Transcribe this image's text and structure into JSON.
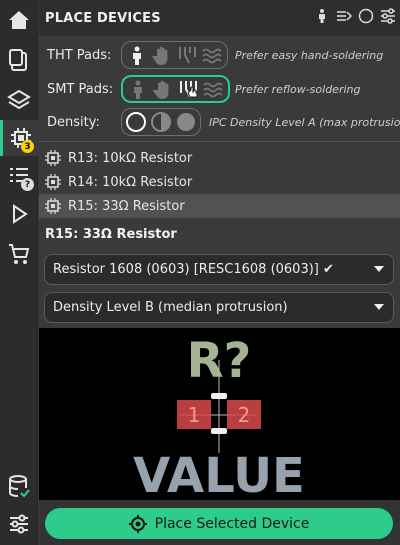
{
  "sidebar": {
    "items": [
      {
        "icon": "home-icon"
      },
      {
        "icon": "clipboard-icon"
      },
      {
        "icon": "layers-icon"
      },
      {
        "icon": "chip-icon",
        "badge": "3"
      },
      {
        "icon": "list-icon",
        "badge": "?"
      },
      {
        "icon": "play-icon"
      },
      {
        "icon": "cart-icon"
      },
      {
        "icon": "database-icon"
      },
      {
        "icon": "settings-sliders-icon"
      }
    ]
  },
  "header": {
    "title": "PLACE DEVICES"
  },
  "options": {
    "tht_label": "THT Pads:",
    "tht_hint": "Prefer easy hand-soldering",
    "smt_label": "SMT Pads:",
    "smt_hint": "Prefer reflow-soldering",
    "density_label": "Density:",
    "density_hint": "IPC Density Level A (max protrusion)"
  },
  "devices": [
    {
      "label": "R13: 10kΩ Resistor"
    },
    {
      "label": "R14: 10kΩ Resistor"
    },
    {
      "label": "R15: 33Ω Resistor"
    }
  ],
  "selected": {
    "title": "R15: 33Ω Resistor",
    "footprint_value": "Resistor 1608 (0603) [RESC1608 (0603)] ✔",
    "density_value": "Density Level B (median protrusion)"
  },
  "preview": {
    "ref_text": "R?",
    "value_text": "VALUE",
    "pad1": "1",
    "pad2": "2"
  },
  "place_button": {
    "label": "Place Selected Device"
  },
  "colors": {
    "accent": "#2ecc8a",
    "badge_yellow": "#f5d400",
    "pad_red": "#d94a4a"
  }
}
